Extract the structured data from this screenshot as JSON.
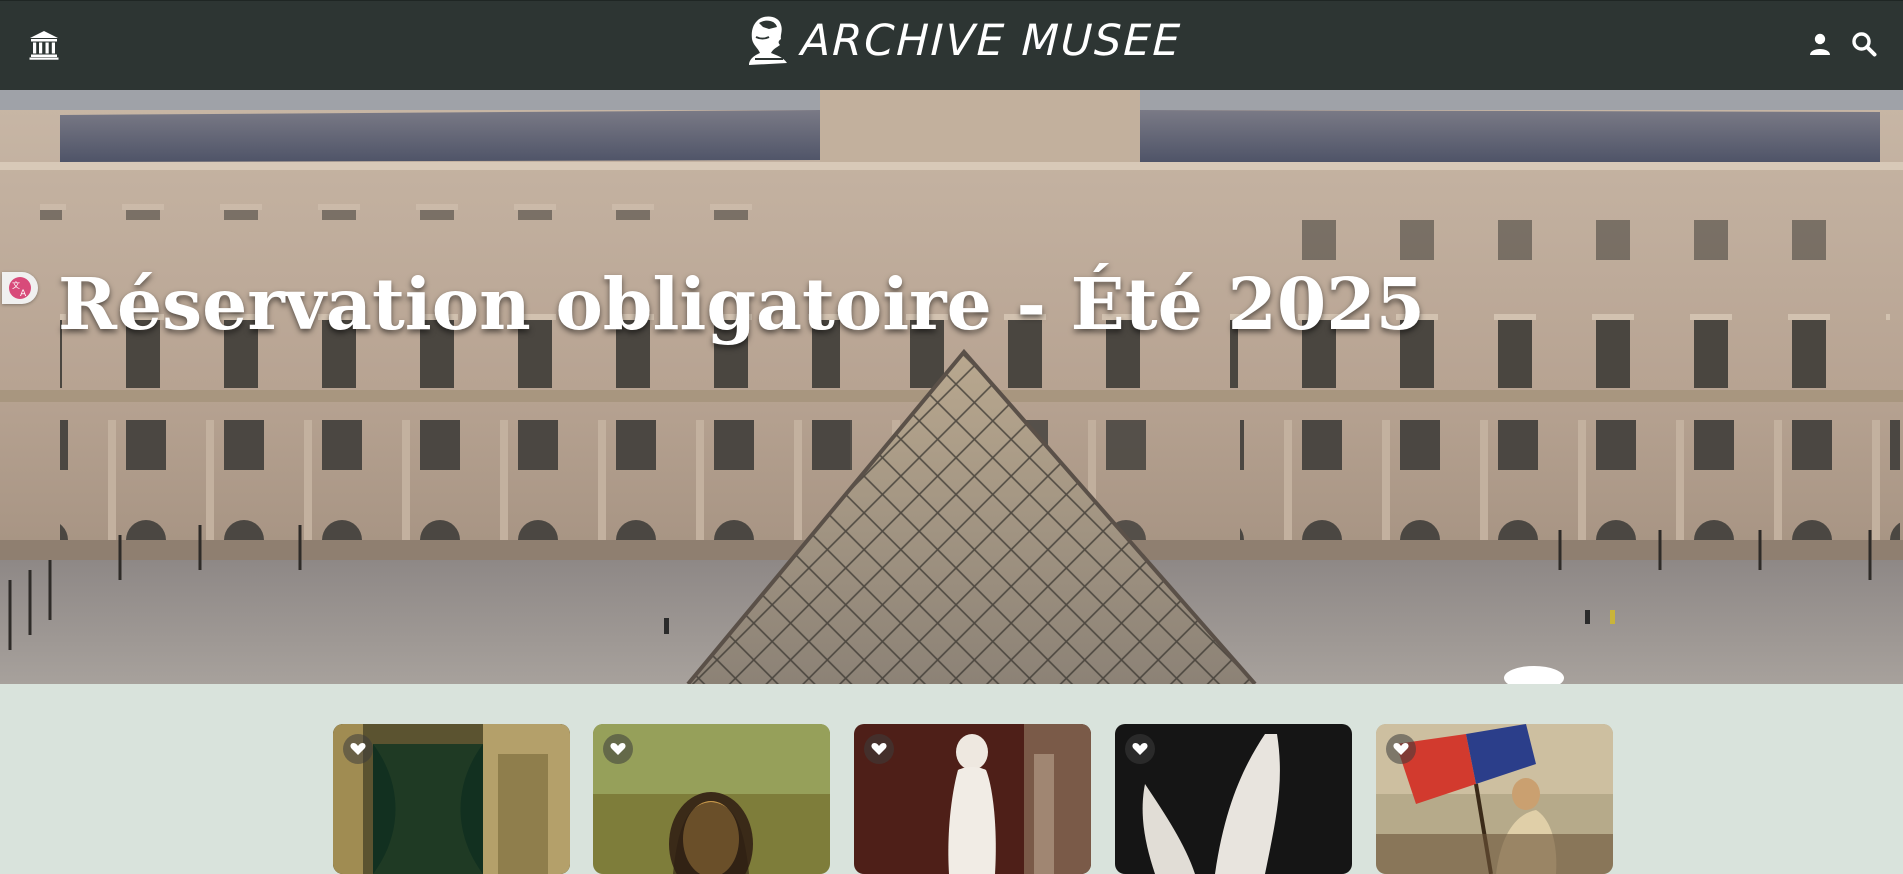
{
  "header": {
    "brand_name": "ARCHIVE MUSEE",
    "icons": {
      "home": "museum-building-icon",
      "brand": "bust-logo-icon",
      "account": "user-icon",
      "search": "search-icon"
    },
    "background_color": "#2d3533"
  },
  "hero": {
    "title": "Réservation obligatoire - Été 2025",
    "image": "louvre-pyramid-photo"
  },
  "translate_widget": {
    "icon": "translate-icon"
  },
  "collection": {
    "cards": [
      {
        "image": "palace-interior-painting",
        "favorite_icon": "heart-icon"
      },
      {
        "image": "mona-lisa-painting",
        "favorite_icon": "heart-icon"
      },
      {
        "image": "venus-de-milo-statue",
        "favorite_icon": "heart-icon"
      },
      {
        "image": "winged-victory-wing",
        "favorite_icon": "heart-icon"
      },
      {
        "image": "liberty-leading-the-people-painting",
        "favorite_icon": "heart-icon"
      }
    ]
  },
  "colors": {
    "page_background": "#d9e3dc",
    "header": "#2d3533",
    "heart": "#ffffff"
  }
}
